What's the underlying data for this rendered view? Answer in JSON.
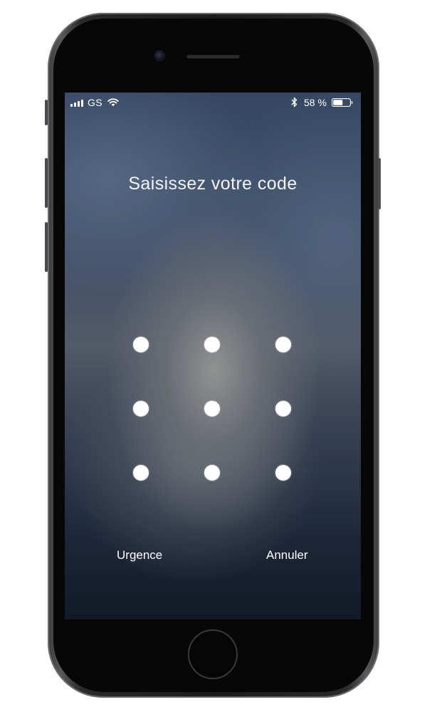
{
  "status_bar": {
    "carrier": "GS",
    "battery_percent": "58 %",
    "signal_bars": 4,
    "battery_level": 0.58,
    "icons": [
      "signal-icon",
      "wifi-icon",
      "bluetooth-icon",
      "battery-icon"
    ]
  },
  "lock_screen": {
    "prompt": "Saisissez votre code",
    "pattern_grid": {
      "rows": 3,
      "cols": 3,
      "dots": [
        "dot-1",
        "dot-2",
        "dot-3",
        "dot-4",
        "dot-5",
        "dot-6",
        "dot-7",
        "dot-8",
        "dot-9"
      ]
    },
    "emergency_label": "Urgence",
    "cancel_label": "Annuler"
  },
  "colors": {
    "text": "#ffffff",
    "phone_frame": "#1b1b1d",
    "wallpaper_top": "#3c4f6c",
    "wallpaper_bottom": "#141b28"
  }
}
